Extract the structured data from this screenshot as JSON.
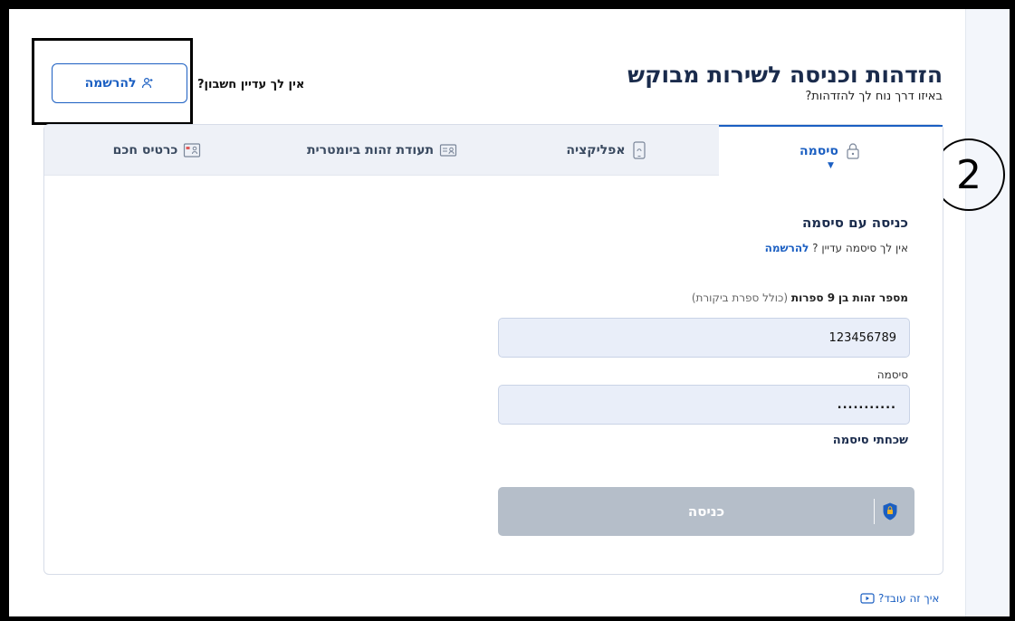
{
  "page": {
    "title": "הזדהות וכניסה לשירות מבוקש",
    "subtitle": "באיזו דרך נוח לך להזדהות?"
  },
  "header": {
    "no_account_text": "אין לך עדיין חשבון?",
    "signup_button_label": "להרשמה"
  },
  "tabs": [
    {
      "label": "סיסמה",
      "icon": "lock-icon",
      "active": true
    },
    {
      "label": "אפליקציה",
      "icon": "phone-icon",
      "active": false
    },
    {
      "label": "תעודת זהות ביומטרית",
      "icon": "id-card-icon",
      "active": false
    },
    {
      "label": "כרטיס חכם",
      "icon": "smart-card-icon",
      "active": false
    }
  ],
  "form": {
    "section_title": "כניסה עם סיסמה",
    "no_password_prefix": "אין לך סיסמה עדיין ?",
    "no_password_link": "להרשמה",
    "id_label_prefix": "מספר זהות בן",
    "id_label_bold": "9 ספרות",
    "id_label_note": "(כולל ספרת ביקורת)",
    "id_value": "123456789",
    "password_label": "סיסמה",
    "password_value": "...........",
    "forgot_password": "שכחתי סיסמה",
    "login_button": "כניסה"
  },
  "footer": {
    "how_it_works": "איך זה עובד?"
  },
  "annotation": {
    "step_number": "2"
  },
  "colors": {
    "primary": "#1b5fc2",
    "title": "#1a2b4c",
    "input_bg": "#e9eef9",
    "button_disabled": "#b5bec9"
  }
}
